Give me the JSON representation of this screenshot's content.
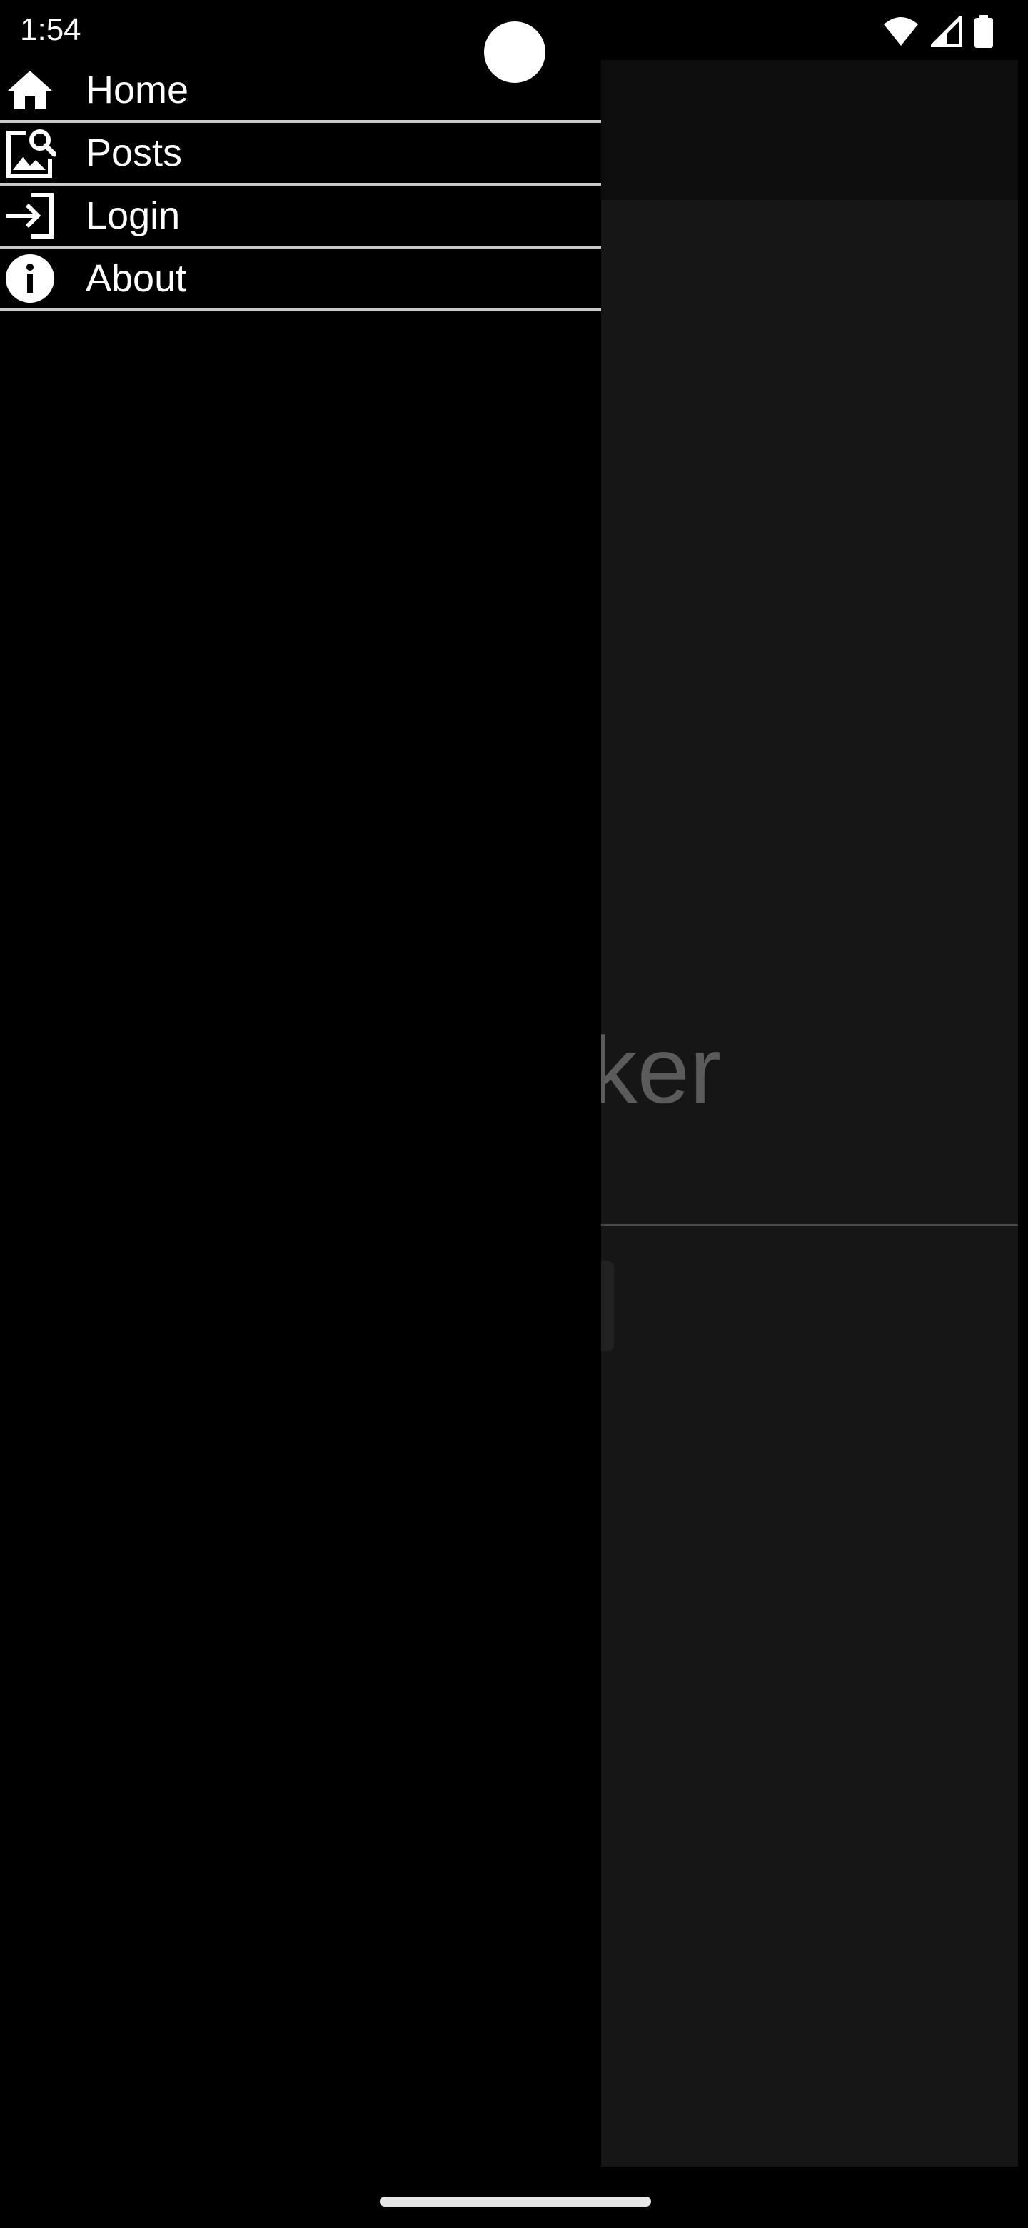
{
  "status_bar": {
    "time": "1:54",
    "icons": [
      "wifi-icon",
      "cell-signal-icon",
      "battery-icon"
    ]
  },
  "drawer": {
    "items": [
      {
        "label": "Home",
        "icon": "home-icon"
      },
      {
        "label": "Posts",
        "icon": "image-search-icon"
      },
      {
        "label": "Login",
        "icon": "login-icon"
      },
      {
        "label": "About",
        "icon": "info-icon"
      }
    ]
  },
  "background_app": {
    "hero_text_fragment": "ker"
  },
  "colors": {
    "drawer_bg": "#000000",
    "scrim_bg": "#161616",
    "divider": "#c9c9c9",
    "text": "#ffffff"
  }
}
